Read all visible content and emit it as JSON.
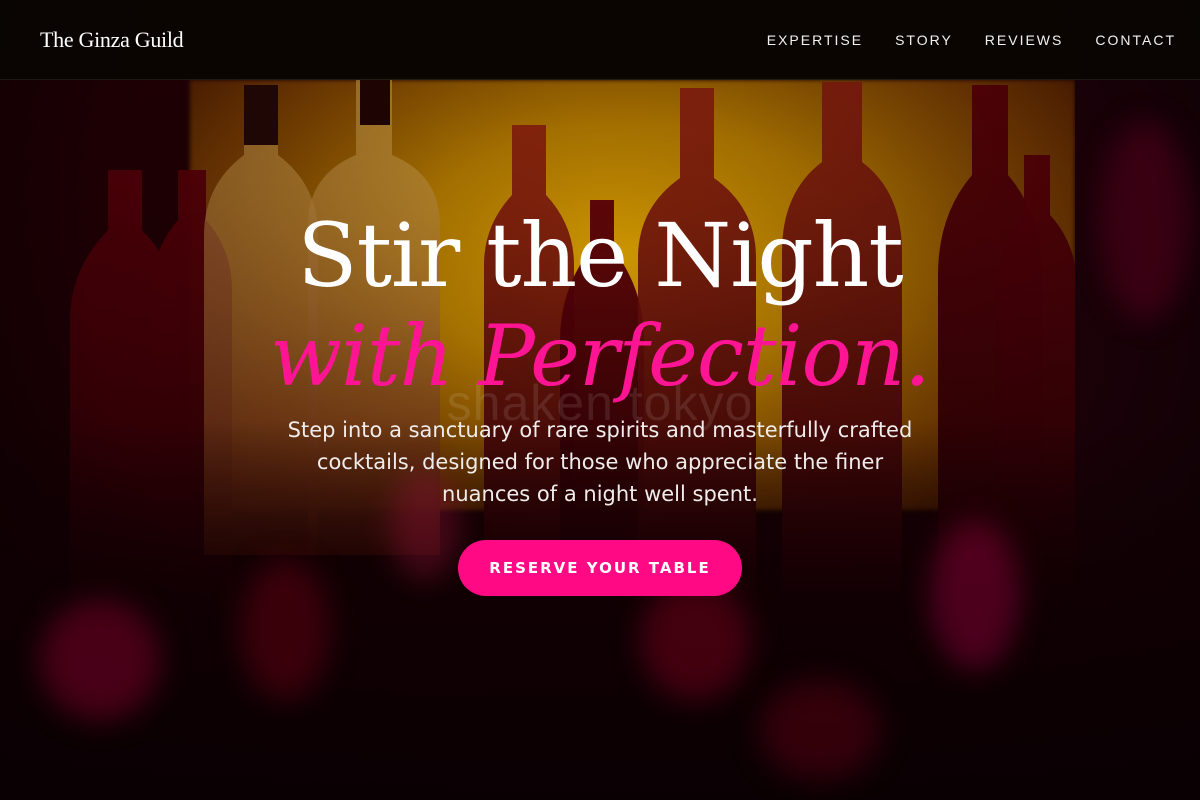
{
  "header": {
    "brand": "The Ginza Guild",
    "nav": [
      {
        "label": "EXPERTISE"
      },
      {
        "label": "STORY"
      },
      {
        "label": "REVIEWS"
      },
      {
        "label": "CONTACT"
      }
    ]
  },
  "hero": {
    "headline_line1": "Stir the Night",
    "headline_line2": "with Perfection.",
    "subtitle": "Step into a sanctuary of rare spirits and masterfully crafted cocktails, designed for those who appreciate the finer nuances of a night well spent.",
    "cta_label": "RESERVE YOUR TABLE",
    "watermark": "shaken tokyo"
  },
  "colors": {
    "accent": "#ff0a84",
    "headline_accent": "#ff1493",
    "header_bg": "#080602",
    "text": "#ffffff"
  },
  "icons": {
    "background_image": "bar-bottles-photo"
  }
}
